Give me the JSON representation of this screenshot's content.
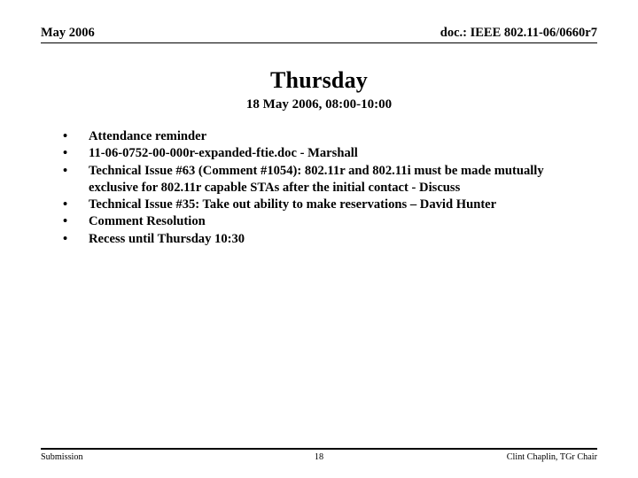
{
  "header": {
    "left": "May 2006",
    "right": "doc.: IEEE 802.11-06/0660r7"
  },
  "title": "Thursday",
  "subtitle": "18 May 2006, 08:00-10:00",
  "bullet_marker": "•",
  "bullets": [
    {
      "text": "Attendance reminder"
    },
    {
      "text": "11-06-0752-00-000r-expanded-ftie.doc - Marshall"
    },
    {
      "text": "Technical Issue #63 (Comment #1054): 802.11r and 802.11i must be made mutually exclusive for 802.11r capable STAs after the initial contact - Discuss"
    },
    {
      "text": "Technical Issue #35: Take out ability to make reservations – David Hunter"
    },
    {
      "text": "Comment Resolution"
    },
    {
      "text": "Recess until Thursday 10:30"
    }
  ],
  "footer": {
    "left": "Submission",
    "page": "18",
    "right": "Clint Chaplin, TGr Chair"
  }
}
